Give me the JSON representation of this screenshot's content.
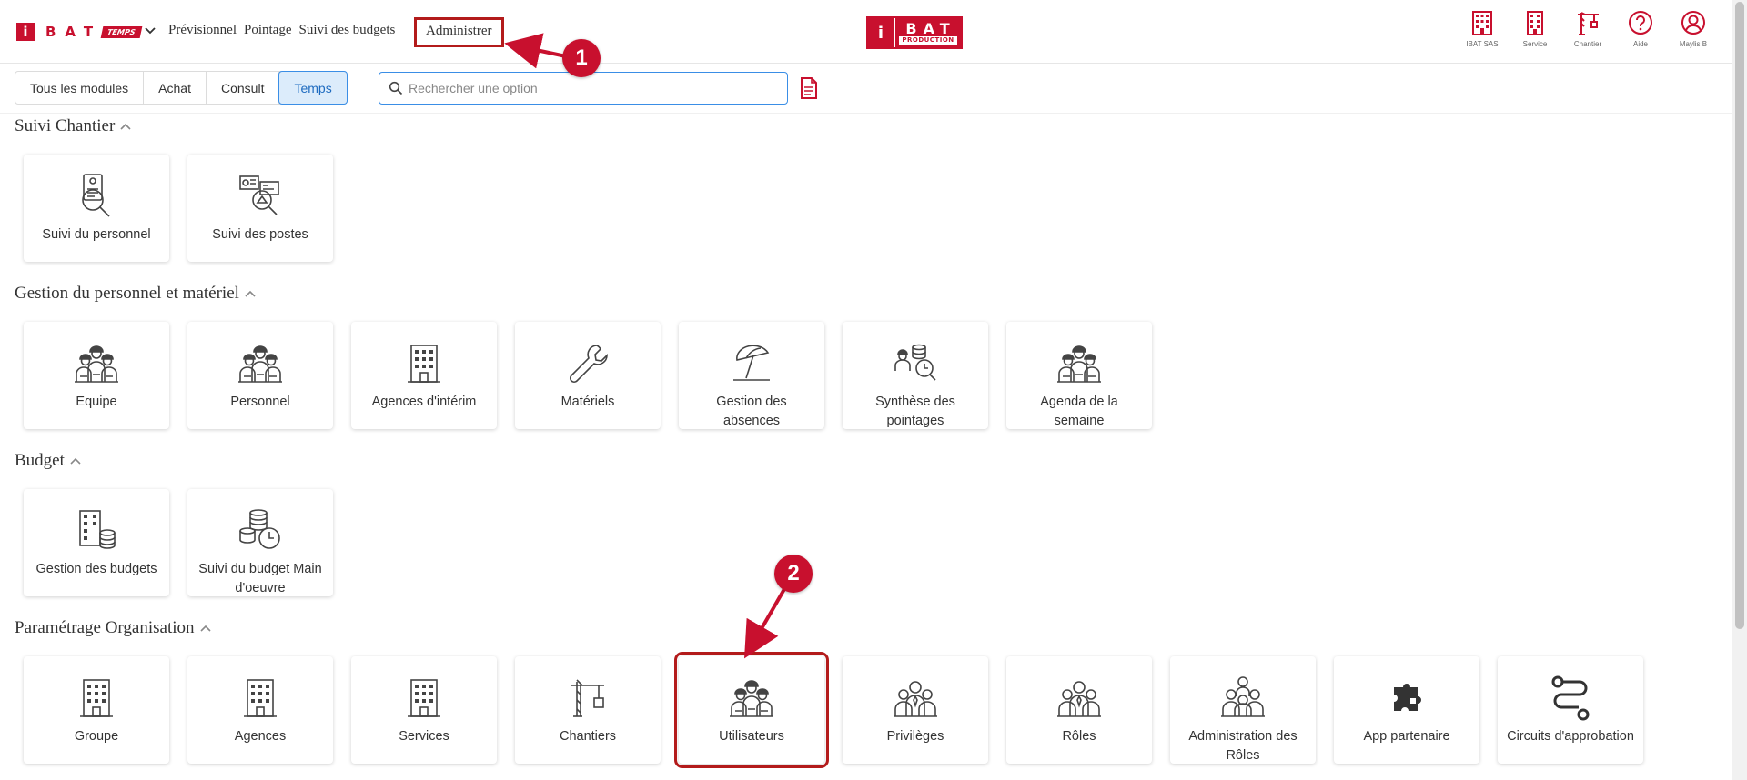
{
  "header": {
    "logo": {
      "i": "i",
      "letters": "BAT",
      "badge": "TEMPS"
    },
    "nav": [
      {
        "label": "Prévisionnel"
      },
      {
        "label": "Pointage"
      },
      {
        "label": "Suivi des budgets"
      }
    ],
    "admin_label": "Administrer",
    "center_logo": {
      "i": "i",
      "bat": "BAT",
      "sub": "PRODUCTION"
    },
    "right_icons": [
      {
        "label": "IBAT SAS",
        "icon": "building-icon"
      },
      {
        "label": "Service",
        "icon": "building-icon"
      },
      {
        "label": "Chantier",
        "icon": "crane-icon"
      },
      {
        "label": "Aide",
        "icon": "help-icon"
      },
      {
        "label": "Maylis B",
        "icon": "user-icon"
      }
    ],
    "accent": "#c8102e"
  },
  "toolbar": {
    "tabs": [
      "Tous les modules",
      "Achat",
      "Consult",
      "Temps"
    ],
    "active_tab": "Temps",
    "search_placeholder": "Rechercher une option"
  },
  "annotations": {
    "callout_1": "1",
    "callout_2": "2"
  },
  "sections": [
    {
      "title": "Suivi Chantier",
      "cards": [
        {
          "label": "Suivi du personnel",
          "icon": "badge-search-icon"
        },
        {
          "label": "Suivi des postes",
          "icon": "chart-search-icon"
        }
      ]
    },
    {
      "title": "Gestion du personnel et matériel",
      "cards": [
        {
          "label": "Equipe",
          "icon": "workers-icon"
        },
        {
          "label": "Personnel",
          "icon": "workers-icon"
        },
        {
          "label": "Agences d'intérim",
          "icon": "building-icon"
        },
        {
          "label": "Matériels",
          "icon": "wrench-icon"
        },
        {
          "label": "Gestion des absences",
          "icon": "beach-umbrella-icon"
        },
        {
          "label": "Synthèse des pointages",
          "icon": "workers-clock-icon"
        },
        {
          "label": "Agenda de la semaine",
          "icon": "workers-icon"
        }
      ]
    },
    {
      "title": "Budget",
      "cards": [
        {
          "label": "Gestion des budgets",
          "icon": "building-coins-icon"
        },
        {
          "label": "Suivi du budget Main d'oeuvre",
          "icon": "coins-clock-icon"
        }
      ]
    },
    {
      "title": "Paramétrage Organisation",
      "cards": [
        {
          "label": "Groupe",
          "icon": "building-icon"
        },
        {
          "label": "Agences",
          "icon": "building-icon"
        },
        {
          "label": "Services",
          "icon": "building-icon"
        },
        {
          "label": "Chantiers",
          "icon": "crane-icon"
        },
        {
          "label": "Utilisateurs",
          "icon": "workers-icon"
        },
        {
          "label": "Privilèges",
          "icon": "people-icon"
        },
        {
          "label": "Rôles",
          "icon": "people-icon"
        },
        {
          "label": "Administration des Rôles",
          "icon": "people-group-icon"
        },
        {
          "label": "App partenaire",
          "icon": "puzzle-icon"
        },
        {
          "label": "Circuits d'approbation",
          "icon": "route-icon"
        }
      ]
    }
  ]
}
